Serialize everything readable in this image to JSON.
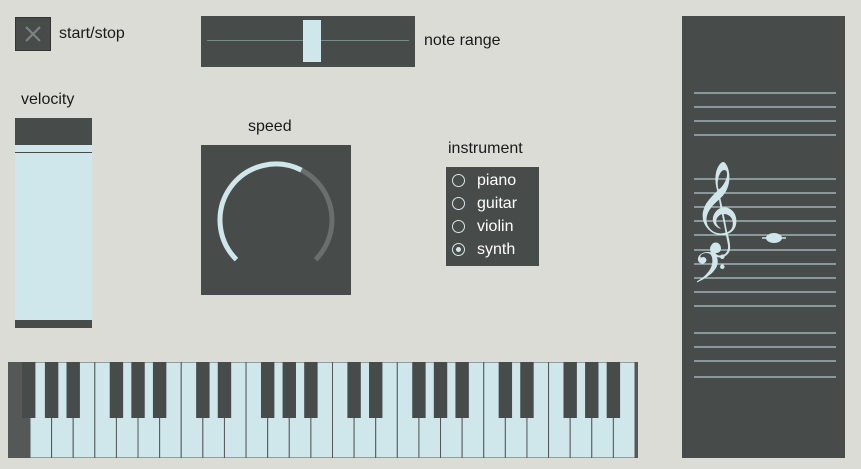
{
  "toggle": {
    "label": "start/stop",
    "icon": "x-icon",
    "state": "off"
  },
  "note_range": {
    "label": "note range",
    "value": 0.52
  },
  "velocity": {
    "label": "velocity",
    "value": 0.9
  },
  "speed": {
    "label": "speed",
    "value": 0.6
  },
  "instrument": {
    "label": "instrument",
    "options": [
      "piano",
      "guitar",
      "violin",
      "synth"
    ],
    "selected_index": 3
  },
  "keyboard": {
    "white_keys": 28
  },
  "staff": {
    "treble_clef": "treble-clef-icon",
    "bass_clef": "bass-clef-icon",
    "note": "whole-note-icon"
  },
  "colors": {
    "background": "#dcdcd7",
    "panel": "#474b49",
    "accent": "#cfe6ea",
    "line": "#d9e6e8",
    "dial_track": "#6a6e6c"
  }
}
